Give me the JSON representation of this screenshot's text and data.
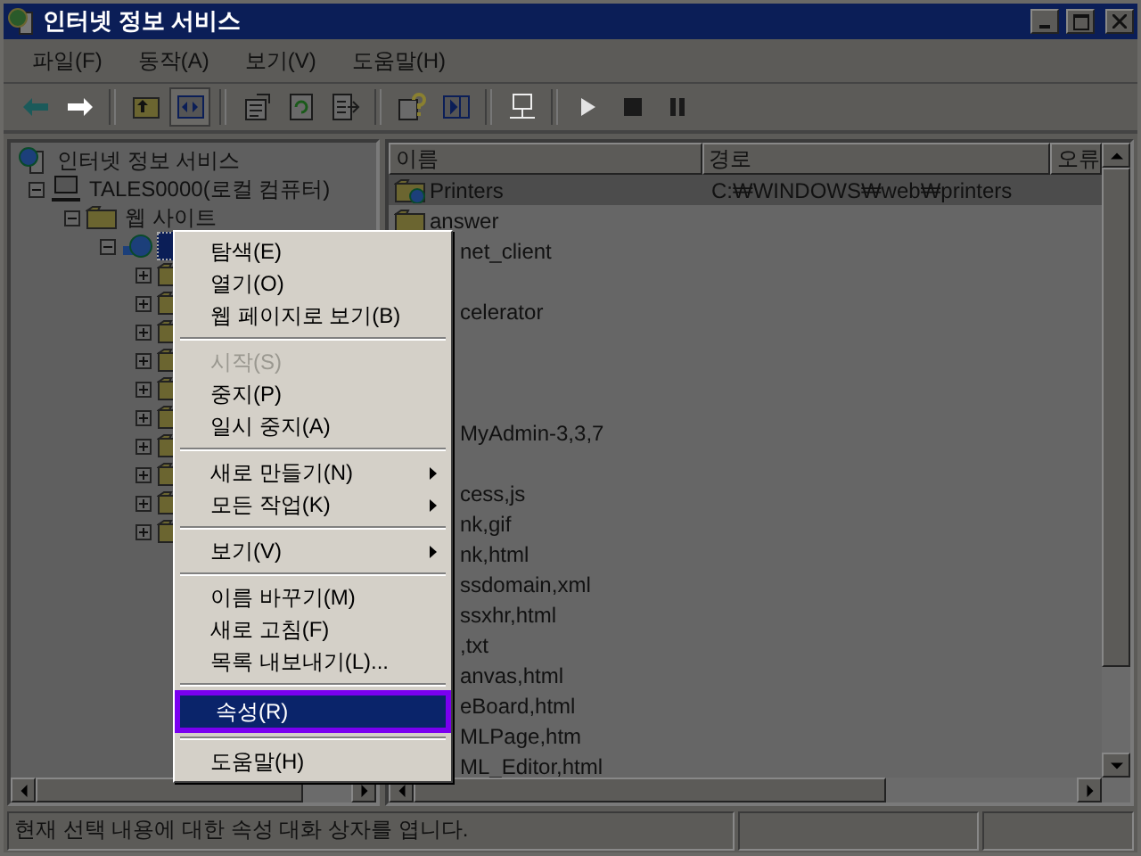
{
  "window": {
    "title": "인터넷 정보 서비스"
  },
  "menu_bar": [
    "파일(F)",
    "동작(A)",
    "보기(V)",
    "도움말(H)"
  ],
  "toolbar": [
    {
      "kind": "back",
      "disabled": false,
      "pressed": false
    },
    {
      "kind": "forward",
      "disabled": true,
      "pressed": false
    },
    {
      "kind": "separator"
    },
    {
      "kind": "up",
      "disabled": false,
      "pressed": false
    },
    {
      "kind": "tree",
      "disabled": false,
      "pressed": true
    },
    {
      "kind": "separator"
    },
    {
      "kind": "properties",
      "disabled": false,
      "pressed": false
    },
    {
      "kind": "refresh",
      "disabled": false,
      "pressed": false
    },
    {
      "kind": "export",
      "disabled": false,
      "pressed": false
    },
    {
      "kind": "separator"
    },
    {
      "kind": "help",
      "disabled": false,
      "pressed": false
    },
    {
      "kind": "panel",
      "disabled": false,
      "pressed": false
    },
    {
      "kind": "separator"
    },
    {
      "kind": "computer",
      "disabled": true,
      "pressed": false
    },
    {
      "kind": "separator"
    },
    {
      "kind": "play",
      "disabled": true,
      "pressed": false
    },
    {
      "kind": "stop",
      "disabled": false,
      "pressed": false
    },
    {
      "kind": "pause",
      "disabled": false,
      "pressed": false
    }
  ],
  "tree": {
    "label": "인터넷 정보 서비스",
    "kind": "root",
    "children": [
      {
        "label": "TALES0000(로컬 컴퓨터)",
        "kind": "computer",
        "expanded": true,
        "children": [
          {
            "label": "웹 사이트",
            "kind": "folder",
            "expanded": true,
            "children": [
              {
                "kind": "site",
                "expanded": true,
                "selected": true,
                "children": [
                  {
                    "kind": "folder",
                    "expanded": false
                  },
                  {
                    "kind": "folder",
                    "expanded": false
                  },
                  {
                    "kind": "folder",
                    "expanded": false
                  },
                  {
                    "kind": "folder",
                    "expanded": false
                  },
                  {
                    "kind": "folder",
                    "expanded": false
                  },
                  {
                    "kind": "folder",
                    "expanded": false
                  },
                  {
                    "kind": "folder",
                    "expanded": false
                  },
                  {
                    "kind": "folder",
                    "expanded": false
                  },
                  {
                    "kind": "folder",
                    "expanded": false
                  },
                  {
                    "kind": "folder",
                    "expanded": false
                  }
                ]
              }
            ]
          }
        ]
      }
    ]
  },
  "list": {
    "columns": [
      "이름",
      "경로",
      "오류"
    ],
    "rows": [
      {
        "kind": "web-folder",
        "name": "Printers",
        "path": "C:₩WINDOWS₩web₩printers",
        "selected": true
      },
      {
        "kind": "folder",
        "name": "answer",
        "selected": false
      },
      {
        "kind": "covered",
        "name": "net_client",
        "selected": false
      },
      {
        "kind": "covered",
        "selected": false
      },
      {
        "kind": "covered",
        "name": "celerator",
        "selected": false
      },
      {
        "kind": "covered",
        "selected": false
      },
      {
        "kind": "covered",
        "selected": false
      },
      {
        "kind": "covered",
        "selected": false
      },
      {
        "kind": "covered",
        "name": "MyAdmin-3,3,7",
        "selected": false
      },
      {
        "kind": "covered",
        "selected": false
      },
      {
        "kind": "covered",
        "name": "cess,js",
        "selected": false
      },
      {
        "kind": "covered",
        "name": "nk,gif",
        "selected": false
      },
      {
        "kind": "covered",
        "name": "nk,html",
        "selected": false
      },
      {
        "kind": "covered",
        "name": "ssdomain,xml",
        "selected": false
      },
      {
        "kind": "covered",
        "name": "ssxhr,html",
        "selected": false
      },
      {
        "kind": "covered",
        "name": ",txt",
        "selected": false
      },
      {
        "kind": "covered",
        "name": "anvas,html",
        "selected": false
      },
      {
        "kind": "covered",
        "name": "eBoard,html",
        "selected": false
      },
      {
        "kind": "covered",
        "name": "MLPage,htm",
        "selected": false
      },
      {
        "kind": "covered",
        "name": "ML_Editor,html",
        "selected": false
      }
    ]
  },
  "context_menu": [
    {
      "kind": "item",
      "label": "탐색(E)",
      "disabled": false,
      "selected": false
    },
    {
      "kind": "item",
      "label": "열기(O)",
      "disabled": false,
      "selected": false
    },
    {
      "kind": "item",
      "label": "웹 페이지로 보기(B)",
      "disabled": false,
      "selected": false
    },
    {
      "kind": "separator"
    },
    {
      "kind": "item",
      "label": "시작(S)",
      "disabled": true,
      "selected": false
    },
    {
      "kind": "item",
      "label": "중지(P)",
      "disabled": false,
      "selected": false
    },
    {
      "kind": "item",
      "label": "일시 중지(A)",
      "disabled": false,
      "selected": false
    },
    {
      "kind": "separator"
    },
    {
      "kind": "submenu",
      "label": "새로 만들기(N)",
      "disabled": false,
      "selected": false
    },
    {
      "kind": "submenu",
      "label": "모든 작업(K)",
      "disabled": false,
      "selected": false
    },
    {
      "kind": "separator"
    },
    {
      "kind": "submenu",
      "label": "보기(V)",
      "disabled": false,
      "selected": false
    },
    {
      "kind": "separator"
    },
    {
      "kind": "item",
      "label": "이름 바꾸기(M)",
      "disabled": false,
      "selected": false
    },
    {
      "kind": "item",
      "label": "새로 고침(F)",
      "disabled": false,
      "selected": false
    },
    {
      "kind": "item",
      "label": "목록 내보내기(L)...",
      "disabled": false,
      "selected": false
    },
    {
      "kind": "separator"
    },
    {
      "kind": "item",
      "label": "속성(R)",
      "disabled": false,
      "selected": true
    },
    {
      "kind": "separator"
    },
    {
      "kind": "item",
      "label": "도움말(H)",
      "disabled": false,
      "selected": false
    }
  ],
  "status_bar": {
    "text": "현재 선택 내용에 대한 속성 대화 상자를 엽니다."
  }
}
